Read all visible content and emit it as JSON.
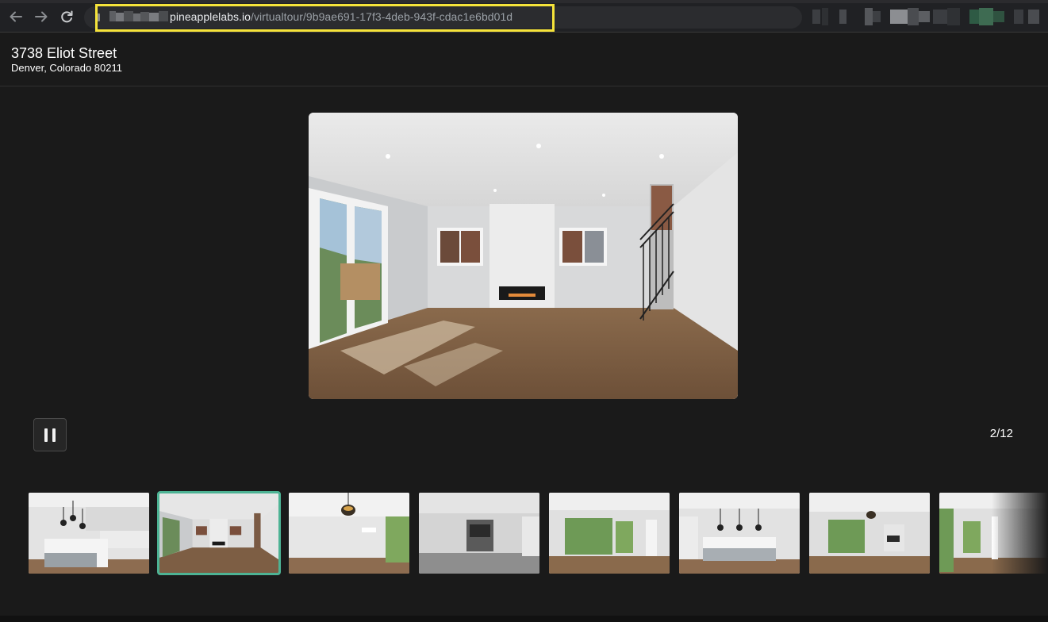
{
  "browser": {
    "url_domain": "pineapplelabs.io",
    "url_path": "/virtualtour/9b9ae691-17f3-4deb-943f-cdac1e6bd01d"
  },
  "listing": {
    "street": "3738 Eliot Street",
    "city_state_zip": "Denver, Colorado 80211"
  },
  "slideshow": {
    "counter": "2/12",
    "current_index": 2,
    "total": 12,
    "state": "playing"
  },
  "thumbnails": [
    {
      "scene": "kitchen",
      "selected": false
    },
    {
      "scene": "living-room-fireplace",
      "selected": true
    },
    {
      "scene": "dining-room",
      "selected": false
    },
    {
      "scene": "basement-room",
      "selected": false
    },
    {
      "scene": "sunroom",
      "selected": false
    },
    {
      "scene": "kitchen-island",
      "selected": false
    },
    {
      "scene": "family-room",
      "selected": false
    },
    {
      "scene": "great-room",
      "selected": false
    }
  ],
  "colors": {
    "background": "#1a1a1a",
    "url_highlight": "#f5e33a",
    "active_thumb_border": "#4db394"
  }
}
